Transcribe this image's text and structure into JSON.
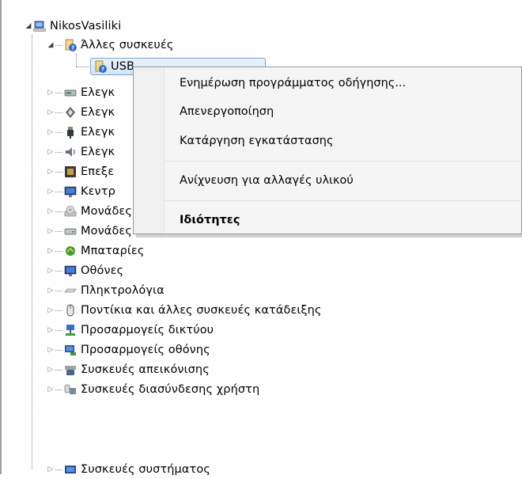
{
  "tree": {
    "root": {
      "label": "NikosVasiliki",
      "icon": "computer-icon"
    },
    "other_devices": {
      "label": "Άλλες συσκευές",
      "icon": "unknown-device-icon",
      "child": {
        "label": "USB Serial Controller",
        "visible_text": "USB",
        "icon": "unknown-device-icon"
      }
    },
    "items": [
      {
        "label": "Ελεγκ",
        "icon": "ide-controller-icon"
      },
      {
        "label": "Ελεγκ",
        "icon": "bluetooth-icon"
      },
      {
        "label": "Ελεγκ",
        "icon": "usb-icon"
      },
      {
        "label": "Ελεγκ",
        "icon": "sound-icon"
      },
      {
        "label": "Επεξε",
        "icon": "processor-icon"
      },
      {
        "label": "Κεντρ",
        "icon": "monitor-icon"
      },
      {
        "label": "Μονάδες DVD/CD-ROM",
        "icon": "dvd-drive-icon"
      },
      {
        "label": "Μονάδες δίσκων",
        "icon": "disk-drive-icon"
      },
      {
        "label": "Μπαταρίες",
        "icon": "battery-icon"
      },
      {
        "label": "Οθόνες",
        "icon": "monitor-icon"
      },
      {
        "label": "Πληκτρολόγια",
        "icon": "keyboard-icon"
      },
      {
        "label": "Ποντίκια και άλλες συσκευές κατάδειξης",
        "icon": "mouse-icon"
      },
      {
        "label": "Προσαρμογείς δικτύου",
        "icon": "network-adapter-icon"
      },
      {
        "label": "Προσαρμογείς οθόνης",
        "icon": "display-adapter-icon"
      },
      {
        "label": "Συσκευές απεικόνισης",
        "icon": "imaging-device-icon"
      },
      {
        "label": "Συσκευές διασύνδεσης χρήστη",
        "icon": "hid-icon"
      },
      {
        "label": "Συσκευές συστήματος",
        "icon": "system-device-icon"
      }
    ]
  },
  "context_menu": {
    "update_driver": "Ενημέρωση προγράμματος οδήγησης...",
    "disable": "Απενεργοποίηση",
    "uninstall": "Κατάργηση εγκατάστασης",
    "scan_hardware": "Ανίχνευση για αλλαγές υλικού",
    "properties": "Ιδιότητες"
  },
  "colors": {
    "selection_border": "#7da2ce",
    "menu_bg": "#f5f5f5",
    "menu_border": "#979797"
  }
}
